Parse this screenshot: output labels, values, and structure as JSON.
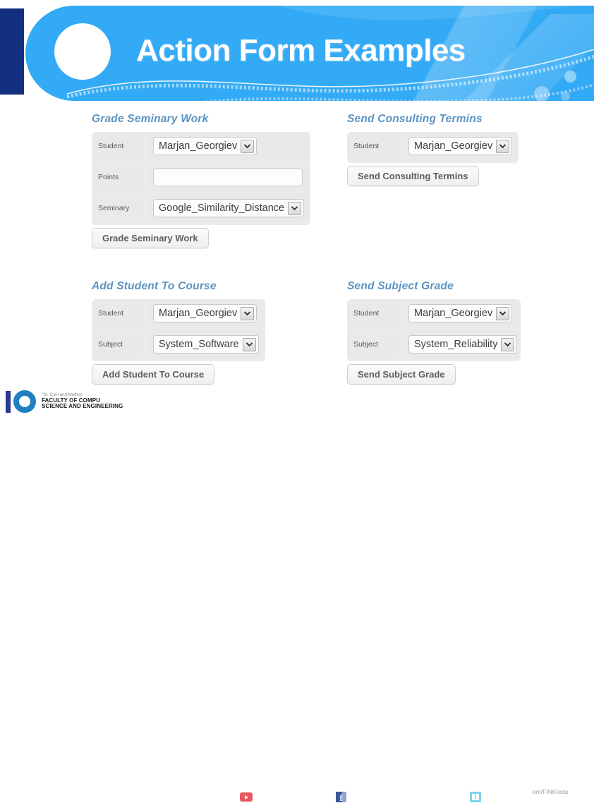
{
  "header": {
    "title": "Action Form Examples",
    "accent_blue": "#33aaf5",
    "navy": "#12307f"
  },
  "forms": [
    {
      "id": "grade-seminary-work",
      "title": "Grade Seminary Work",
      "fields": [
        {
          "label": "Student",
          "type": "select",
          "value": "Marjan_Georgiev"
        },
        {
          "label": "Points",
          "type": "text",
          "value": "",
          "placeholder": ""
        },
        {
          "label": "Seminary",
          "type": "select",
          "value": "Google_Similarity_Distance"
        }
      ],
      "button": "Grade Seminary Work"
    },
    {
      "id": "send-consulting-termins",
      "title": "Send Consulting Termins",
      "fields": [
        {
          "label": "Student",
          "type": "select",
          "value": "Marjan_Georgiev"
        }
      ],
      "button": "Send Consulting Termins"
    },
    {
      "id": "add-student-to-course",
      "title": "Add Student To Course",
      "fields": [
        {
          "label": "Student",
          "type": "select",
          "value": "Marjan_Georgiev"
        },
        {
          "label": "Subject",
          "type": "select",
          "value": "System_Software"
        }
      ],
      "button": "Add Student To Course"
    },
    {
      "id": "send-subject-grade",
      "title": "Send Subject Grade",
      "fields": [
        {
          "label": "Student",
          "type": "select",
          "value": "Marjan_Georgiev"
        },
        {
          "label": "Subject",
          "type": "select",
          "value": "System_Reliability"
        }
      ],
      "button": "Send Subject Grade"
    }
  ],
  "footer": {
    "logo": {
      "line1": "\"St. Cyril and Methoc",
      "line2": "FACULTY OF COMPU",
      "line3": "SCIENCE AND ENGINEERING"
    },
    "social": [
      {
        "name": "youtube-icon"
      },
      {
        "name": "facebook-icon",
        "glyph": "f"
      },
      {
        "name": "twitter-icon",
        "glyph": "t"
      }
    ],
    "url": "om/FINKIedu"
  }
}
